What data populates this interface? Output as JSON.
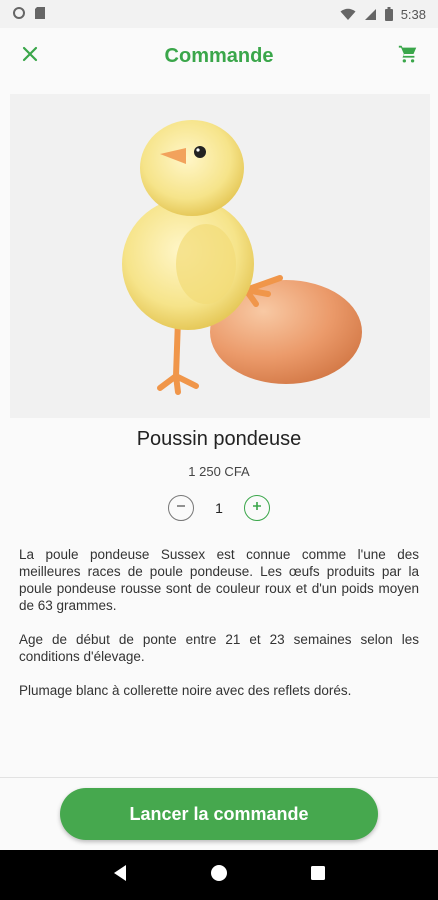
{
  "status_bar": {
    "time": "5:38",
    "icons": [
      "circle-icon",
      "sd-card-icon",
      "wifi-icon",
      "signal-icon",
      "battery-icon"
    ]
  },
  "app_bar": {
    "title": "Commande",
    "close_icon": "close-icon",
    "cart_icon": "cart-icon"
  },
  "product": {
    "name": "Poussin pondeuse",
    "price": "1 250 CFA",
    "quantity": "1",
    "description": [
      "La poule pondeuse Sussex est connue comme l'une des meilleures races de poule pondeuse. Les œufs produits par la poule pondeuse rousse sont de couleur roux et d'un poids moyen de 63 grammes.",
      "Age de début de ponte entre 21 et 23 semaines selon les conditions d'élevage.",
      "Plumage blanc à collerette noire avec des reflets dorés."
    ]
  },
  "actions": {
    "order_label": "Lancer la commande"
  },
  "colors": {
    "accent": "#3aa64a",
    "button": "#46a84e"
  },
  "nav_bar": {
    "icons": [
      "back-icon",
      "home-icon",
      "recents-icon"
    ]
  }
}
